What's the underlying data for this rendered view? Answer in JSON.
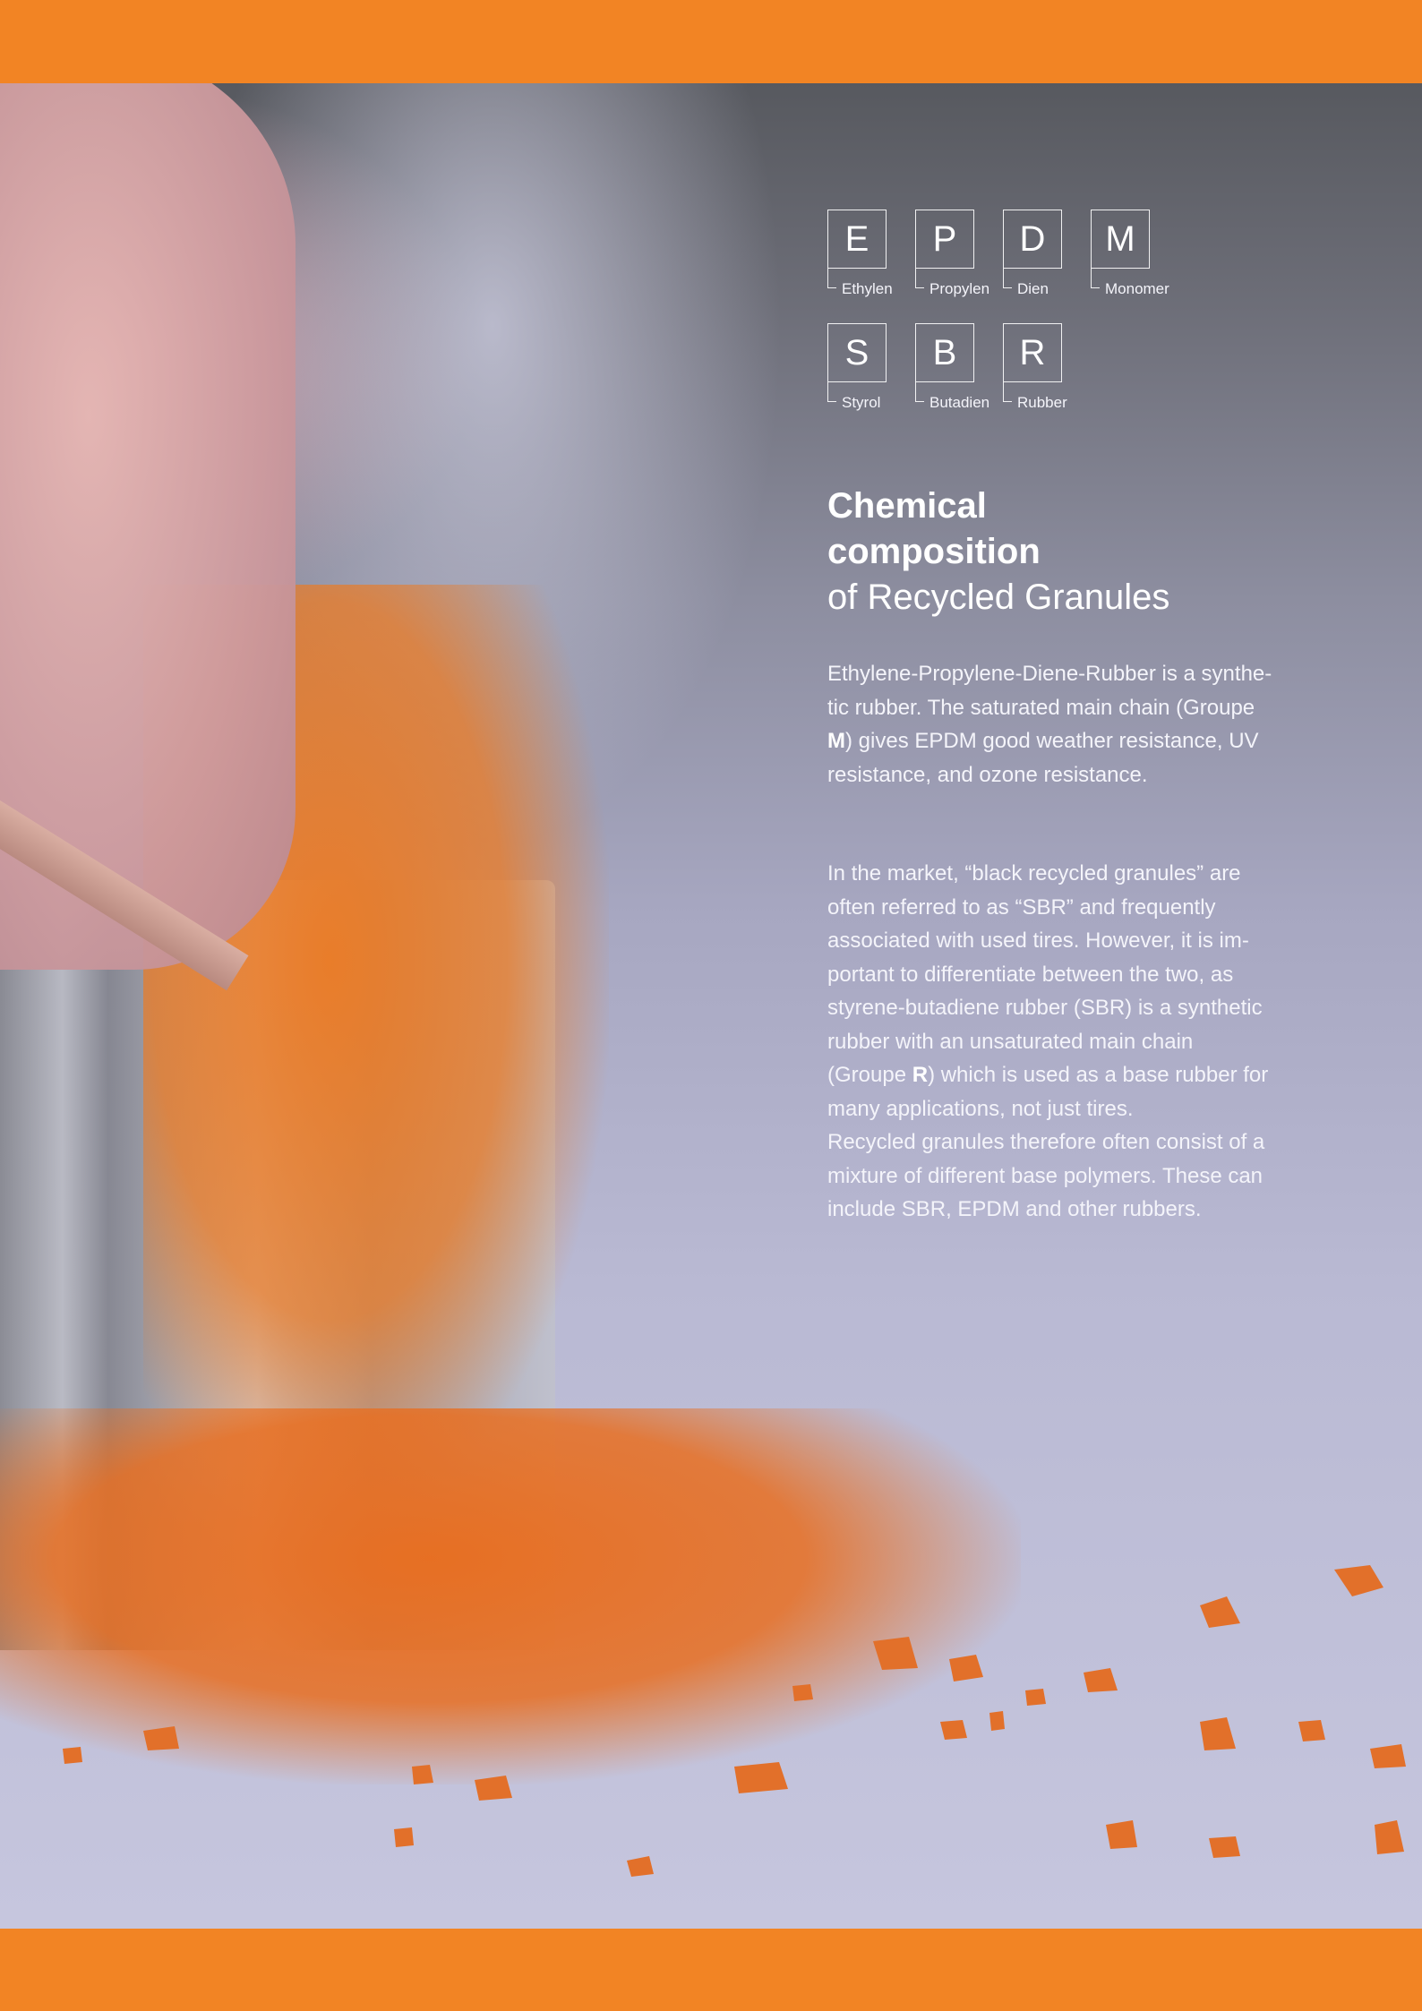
{
  "colors": {
    "accent_band": "#f28424",
    "text": "#ffffff"
  },
  "photo": {
    "icon": "recycled-orange-granules-photo"
  },
  "acronyms": {
    "row1": [
      {
        "letter": "E",
        "word": "Ethylen"
      },
      {
        "letter": "P",
        "word": "Propylen"
      },
      {
        "letter": "D",
        "word": "Dien"
      },
      {
        "letter": "M",
        "word": "Monomer"
      }
    ],
    "row2": [
      {
        "letter": "S",
        "word": "Styrol"
      },
      {
        "letter": "B",
        "word": "Butadien"
      },
      {
        "letter": "R",
        "word": "Rubber"
      }
    ]
  },
  "heading": {
    "line1": "Chemical",
    "line2": "composition",
    "line3": "of Recycled Granules"
  },
  "paragraph1": {
    "line1": "Ethylene-Propylene-Diene-Rubber is a synthe-",
    "line2": "tic rubber. The saturated main chain (Groupe",
    "line3_bold": "M",
    "line3_rest": ") gives EPDM good weather resistance, UV",
    "line4": "resistance, and ozone resistance."
  },
  "paragraph2": {
    "line1": "In the market, “black recycled granules” are",
    "line2": "often referred to as “SBR” and frequently",
    "line3": "associated with used tires. However, it is im-",
    "line4": "portant to differentiate between the two, as",
    "line5": "styrene-butadiene rubber (SBR) is a synthetic",
    "line6": "rubber with an unsaturated main chain",
    "line7_pre": "(Groupe ",
    "line7_bold": "R",
    "line7_post": ") which is used as a base rubber for",
    "line8": "many applications, not just tires.",
    "line9": "Recycled granules therefore often consist of a",
    "line10": "mixture of different base polymers. These can",
    "line11": "include SBR, EPDM and other rubbers."
  }
}
